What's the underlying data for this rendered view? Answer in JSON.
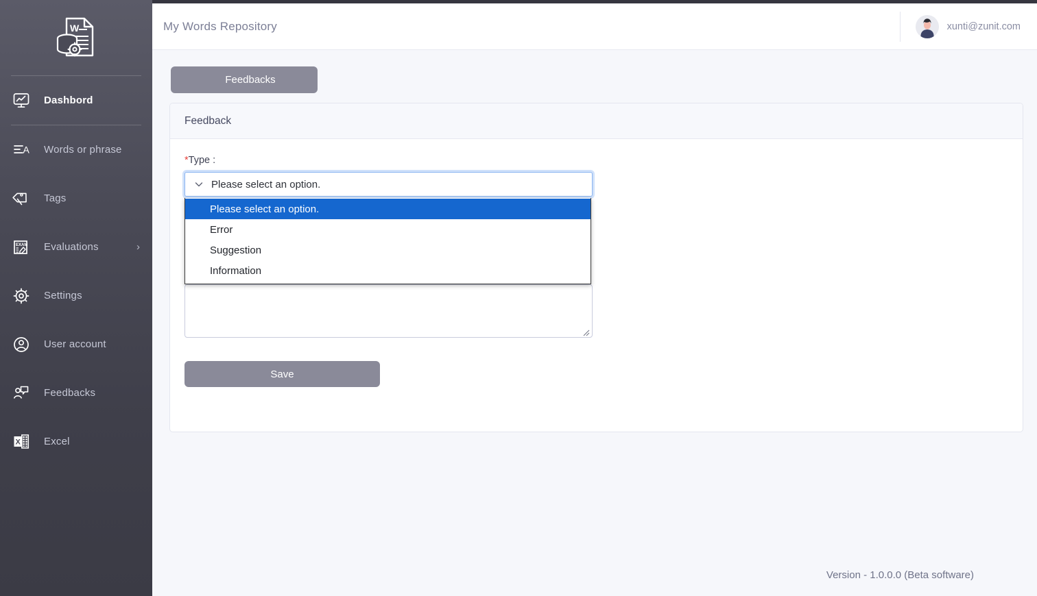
{
  "app": {
    "logo_icon": "word-document-database-gear-icon"
  },
  "sidebar": {
    "items": [
      {
        "label": "Dashbord",
        "icon": "dashboard-monitor-chart-icon",
        "active": true,
        "chevron": ""
      },
      {
        "label": "Words or phrase",
        "icon": "text-lines-a-icon",
        "active": false,
        "chevron": ""
      },
      {
        "label": "Tags",
        "icon": "tags-icon",
        "active": false,
        "chevron": ""
      },
      {
        "label": "Evaluations",
        "icon": "exam-checklist-icon",
        "active": false,
        "chevron": "›"
      },
      {
        "label": "Settings",
        "icon": "gear-icon",
        "active": false,
        "chevron": ""
      },
      {
        "label": "User account",
        "icon": "user-circle-icon",
        "active": false,
        "chevron": ""
      },
      {
        "label": "Feedbacks",
        "icon": "person-speech-bubble-icon",
        "active": false,
        "chevron": ""
      },
      {
        "label": "Excel",
        "icon": "excel-file-icon",
        "active": false,
        "chevron": ""
      }
    ]
  },
  "header": {
    "title": "My Words Repository",
    "user_email": "xunti@zunit.com",
    "avatar_icon": "user-avatar"
  },
  "main": {
    "tab_label": "Feedbacks",
    "card_title": "Feedback",
    "form": {
      "type_label": "Type :",
      "required_marker": "*",
      "select": {
        "value": "Please select an option.",
        "chevron_icon": "chevron-down-icon",
        "options": [
          {
            "label": "Please select an option.",
            "selected": true
          },
          {
            "label": "Error",
            "selected": false
          },
          {
            "label": "Suggestion",
            "selected": false
          },
          {
            "label": "Information",
            "selected": false
          }
        ]
      },
      "description": {
        "value": "",
        "placeholder": ""
      },
      "save_label": "Save"
    }
  },
  "footer": {
    "version": "Version - 1.0.0.0 (Beta software)"
  },
  "colors": {
    "sidebar_dark": "#3b3b45",
    "sidebar_light": "#5b5b68",
    "accent_blue": "#1567cf",
    "focus_ring": "#8ab4f0",
    "button_slate": "#8a8a99",
    "required_red": "#e8403a",
    "content_bg": "#f6f7fb"
  }
}
